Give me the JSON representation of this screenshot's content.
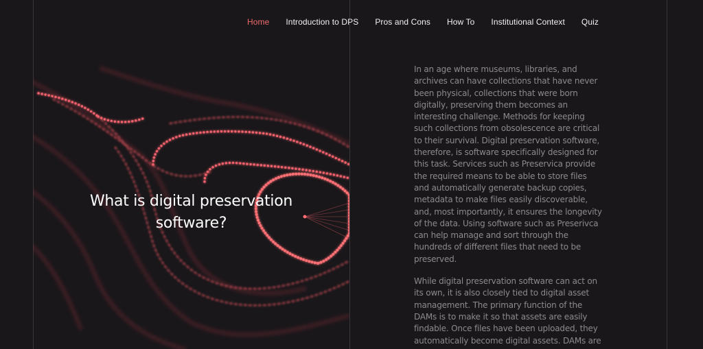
{
  "nav": {
    "items": [
      {
        "label": "Home",
        "active": true
      },
      {
        "label": "Introduction to DPS",
        "active": false
      },
      {
        "label": "Pros and Cons",
        "active": false
      },
      {
        "label": "How To",
        "active": false
      },
      {
        "label": "Institutional Context",
        "active": false
      },
      {
        "label": "Quiz",
        "active": false
      }
    ]
  },
  "hero": {
    "title": "What is digital preservation software?"
  },
  "content": {
    "paragraph_1": "In an age where museums, libraries, and archives can have collections that have never been physical, collections that were born digitally, preserving them becomes an interesting challenge. Methods for keeping such collections from obsolescence are critical to their survival. Digital preservation software, therefore, is software specifically designed for this task. Services such as Preservica provide the required means to be able to store files and automatically generate backup copies, metadata to make files easily discoverable, and, most importantly, it ensures the longevity of the data. Using software such as Preserivca can help manage and sort through the hundreds of different files that need to be preserved.",
    "paragraph_2": "While digital preservation software can act on its own, it is also closely tied to digital asset management. The primary function of the DAMs is to make it so that assets are easily findable. Once files have been uploaded, they automatically become digital assets. DAMs are"
  },
  "colors": {
    "background": "#19171a",
    "accent": "#ef6b6b",
    "nav_text": "#f2f2f2",
    "body_text": "#8d8a8e",
    "divider": "#3a373b"
  }
}
